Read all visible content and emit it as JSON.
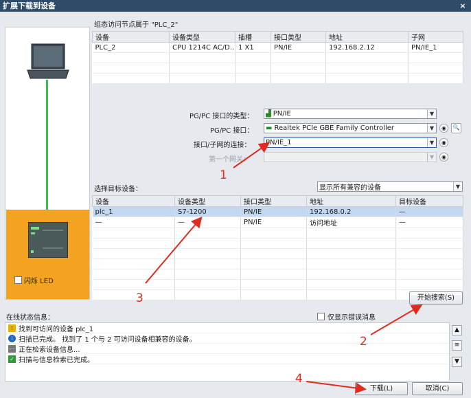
{
  "window": {
    "title": "扩展下载到设备",
    "close": "×"
  },
  "access_nodes": {
    "caption": "组态访问节点属于 \"PLC_2\"",
    "columns": [
      "设备",
      "设备类型",
      "插槽",
      "接口类型",
      "地址",
      "子网"
    ],
    "rows": [
      [
        "PLC_2",
        "CPU 1214C AC/D...",
        "1 X1",
        "PN/IE",
        "192.168.2.12",
        "PN/IE_1"
      ]
    ]
  },
  "interface": {
    "pgpc_type_label": "PG/PC 接口的类型：",
    "pgpc_type_value": "PN/IE",
    "pgpc_iface_label": "PG/PC 接口：",
    "pgpc_iface_value": "Realtek PCIe GBE Family Controller",
    "subnet_label": "接口/子网的连接：",
    "subnet_value": "PN/IE_1",
    "gateway_label": "第一个网关："
  },
  "target": {
    "caption": "选择目标设备：",
    "filter_value": "显示所有兼容的设备",
    "columns": [
      "设备",
      "设备类型",
      "接口类型",
      "地址",
      "目标设备"
    ],
    "rows": [
      [
        "plc_1",
        "S7-1200",
        "PN/IE",
        "192.168.0.2",
        "—"
      ],
      [
        "—",
        "—",
        "PN/IE",
        "访问地址",
        "—"
      ]
    ]
  },
  "left": {
    "flash_label": "闪烁 LED"
  },
  "search_button": "开始搜索(S)",
  "status": {
    "caption": "在线状态信息：",
    "errors_only": "仅显示错误消息",
    "messages": [
      {
        "icon": "warning-icon",
        "color": "#e8b400",
        "text": "找到可访问的设备 plc_1"
      },
      {
        "icon": "info-icon",
        "color": "#1f64c8",
        "text": "扫描已完成。 找到了 1 个与 2 可访问设备相兼容的设备。"
      },
      {
        "icon": "search-progress-icon",
        "color": "#777777",
        "text": "正在检索设备信息..."
      },
      {
        "icon": "check-icon",
        "color": "#2f9b3a",
        "text": "扫描与信息检索已完成。"
      }
    ]
  },
  "footer": {
    "download": "下载(L)",
    "cancel": "取消(C)"
  },
  "annotations": [
    "1",
    "2",
    "3",
    "4"
  ],
  "colors": {
    "accent": "#2e4b68",
    "plc_panel": "#f4a321",
    "link": "#39c24a",
    "annotation": "#e02b20"
  }
}
